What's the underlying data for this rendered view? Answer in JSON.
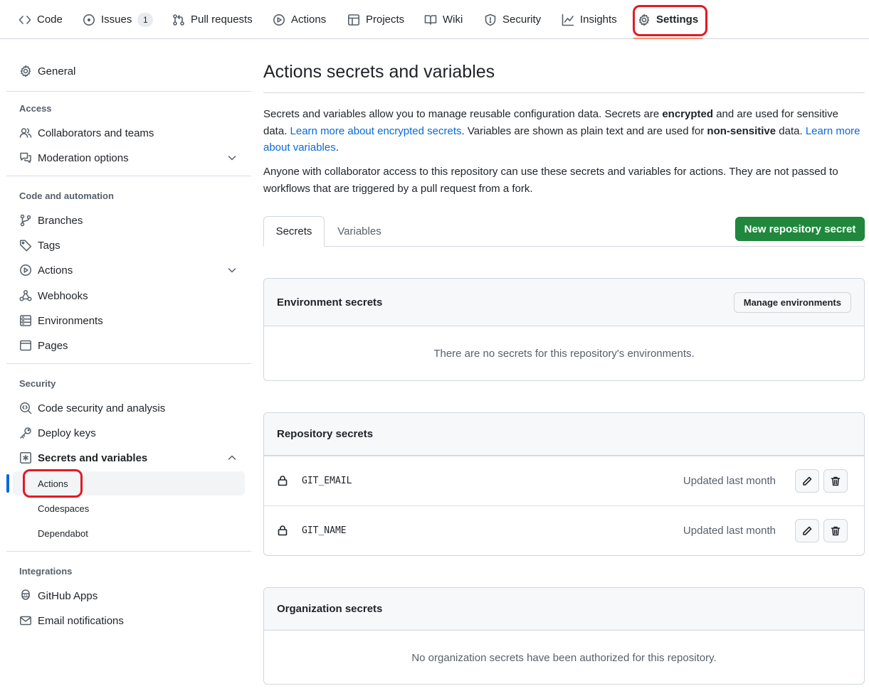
{
  "repo_nav": {
    "tabs": [
      {
        "label": "Code",
        "icon": "code-icon"
      },
      {
        "label": "Issues",
        "icon": "issue-icon",
        "counter": "1"
      },
      {
        "label": "Pull requests",
        "icon": "pull-request-icon"
      },
      {
        "label": "Actions",
        "icon": "play-icon"
      },
      {
        "label": "Projects",
        "icon": "table-icon"
      },
      {
        "label": "Wiki",
        "icon": "book-icon"
      },
      {
        "label": "Security",
        "icon": "shield-icon"
      },
      {
        "label": "Insights",
        "icon": "graph-icon"
      },
      {
        "label": "Settings",
        "icon": "gear-icon",
        "selected": true
      }
    ]
  },
  "sidebar": {
    "general": "General",
    "sections": [
      {
        "heading": "Access",
        "items": [
          "Collaborators and teams",
          "Moderation options"
        ]
      },
      {
        "heading": "Code and automation",
        "items": [
          "Branches",
          "Tags",
          "Actions",
          "Webhooks",
          "Environments",
          "Pages"
        ]
      },
      {
        "heading": "Security",
        "items": [
          "Code security and analysis",
          "Deploy keys",
          "Secrets and variables"
        ],
        "subitems": [
          "Actions",
          "Codespaces",
          "Dependabot"
        ]
      },
      {
        "heading": "Integrations",
        "items": [
          "GitHub Apps",
          "Email notifications"
        ]
      }
    ]
  },
  "main": {
    "title": "Actions secrets and variables",
    "desc1": {
      "p1": "Secrets and variables allow you to manage reusable configuration data. Secrets are ",
      "b1": "encrypted",
      "p2": " and are used for sensitive data. ",
      "link1": "Learn more about encrypted secrets",
      "p3": ". Variables are shown as plain text and are used for ",
      "b2": "non-sensitive",
      "p4": " data. ",
      "link2": "Learn more about variables",
      "p5": "."
    },
    "desc2": "Anyone with collaborator access to this repository can use these secrets and variables for actions. They are not passed to workflows that are triggered by a pull request from a fork.",
    "tabs": [
      "Secrets",
      "Variables"
    ],
    "new_secret_button": "New repository secret",
    "environment_secrets": {
      "title": "Environment secrets",
      "manage_button": "Manage environments",
      "empty": "There are no secrets for this repository's environments."
    },
    "repository_secrets": {
      "title": "Repository secrets",
      "rows": [
        {
          "name": "GIT_EMAIL",
          "updated": "Updated last month"
        },
        {
          "name": "GIT_NAME",
          "updated": "Updated last month"
        }
      ]
    },
    "organization_secrets": {
      "title": "Organization secrets",
      "empty": "No organization secrets have been authorized for this repository."
    }
  }
}
